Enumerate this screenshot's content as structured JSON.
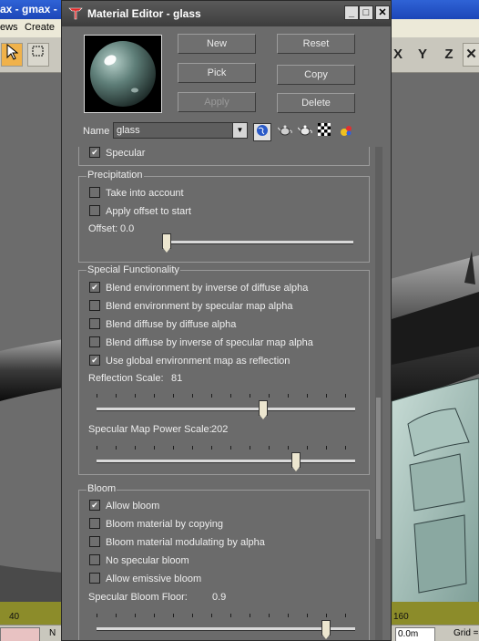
{
  "background_app": {
    "title": "ax - gmax -",
    "menus": [
      "ews",
      "Create"
    ],
    "axis_buttons": [
      "X",
      "Y",
      "Z"
    ],
    "timeline_labels": [
      "40",
      "160"
    ],
    "status_fields": [
      "N",
      "0.0m",
      "Grid ="
    ]
  },
  "editor": {
    "title": "Material Editor - glass",
    "buttons": {
      "new": "New",
      "reset": "Reset",
      "pick": "Pick",
      "copy": "Copy",
      "apply": "Apply",
      "delete": "Delete"
    },
    "name_label": "Name",
    "name_value": "glass",
    "tool_icons": [
      "globe-icon",
      "teapot-icon",
      "teapot-light-icon",
      "checker-icon",
      "color-spheres-icon"
    ],
    "specular_checkbox": {
      "label": "Specular",
      "checked": true
    },
    "precipitation": {
      "title": "Precipitation",
      "take_into_account": {
        "label": "Take into account",
        "checked": false
      },
      "apply_offset": {
        "label": "Apply offset to start",
        "checked": false
      },
      "offset_label": "Offset:",
      "offset_value": "0.0",
      "offset_level": 0.0
    },
    "special": {
      "title": "Special Functionality",
      "options": [
        {
          "label": "Blend environment by inverse of diffuse alpha",
          "checked": true
        },
        {
          "label": "Blend environment by specular map alpha",
          "checked": false
        },
        {
          "label": "Blend diffuse by diffuse alpha",
          "checked": false
        },
        {
          "label": "Blend diffuse by inverse of specular map alpha",
          "checked": false
        },
        {
          "label": "Use global environment map as reflection",
          "checked": true
        }
      ],
      "reflection_label": "Reflection Scale:",
      "reflection_value": "81",
      "reflection_level": 0.65,
      "spec_power_label": "Specular Map Power Scale:",
      "spec_power_value": "202",
      "spec_power_level": 0.78
    },
    "bloom": {
      "title": "Bloom",
      "options": [
        {
          "label": "Allow bloom",
          "checked": true
        },
        {
          "label": "Bloom material by copying",
          "checked": false
        },
        {
          "label": "Bloom material modulating by alpha",
          "checked": false
        },
        {
          "label": "No specular bloom",
          "checked": false
        },
        {
          "label": "Allow emissive bloom",
          "checked": false
        }
      ],
      "floor_label": "Specular Bloom Floor:",
      "floor_value": "0.9",
      "floor_level": 0.9
    }
  }
}
